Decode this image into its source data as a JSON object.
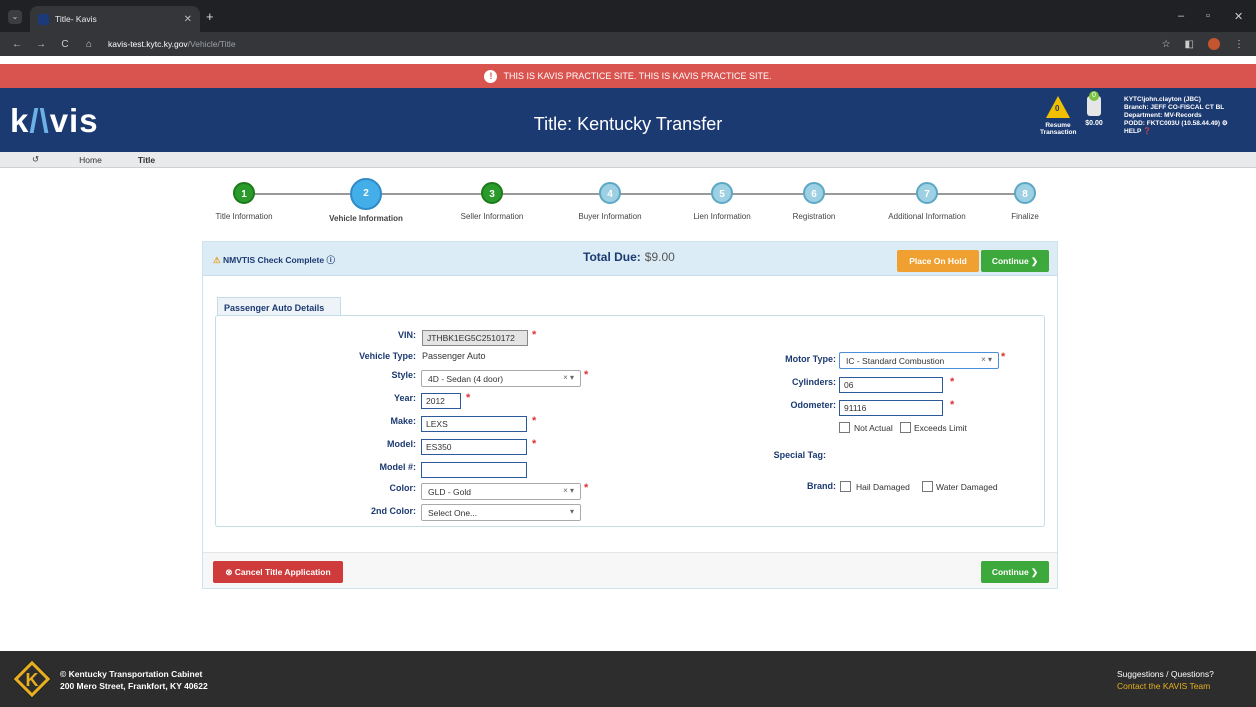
{
  "browser": {
    "tab_title": "Title- Kavis",
    "url_domain": "kavis-test.kytc.ky.gov",
    "url_path": "/Vehicle/Title"
  },
  "banner": {
    "text": "THIS IS KAVIS PRACTICE SITE. THIS IS KAVIS PRACTICE SITE."
  },
  "header": {
    "logo_k": "k",
    "logo_a": "/\\",
    "logo_rest": "vis",
    "title": "Title: Kentucky Transfer",
    "resume_count": "0",
    "resume_label_1": "Resume",
    "resume_label_2": "Transaction",
    "cart_count": "0",
    "cart_amount": "$0.00",
    "user_line1": "KYTC\\john.clayton (JBC)",
    "user_line2": "Branch: JEFF CO-FISCAL CT BL",
    "user_line3": "Department: MV-Records",
    "user_line4": "PODD: FKTC003U (10.58.44.49) ⚙",
    "help": "HELP ❓"
  },
  "breadcrumb": {
    "back": "↺",
    "home": "Home",
    "current": "Title"
  },
  "steps": [
    {
      "num": "1",
      "label": "Title Information"
    },
    {
      "num": "2",
      "label": "Vehicle Information"
    },
    {
      "num": "3",
      "label": "Seller Information"
    },
    {
      "num": "4",
      "label": "Buyer Information"
    },
    {
      "num": "5",
      "label": "Lien Information"
    },
    {
      "num": "6",
      "label": "Registration"
    },
    {
      "num": "7",
      "label": "Additional Information"
    },
    {
      "num": "8",
      "label": "Finalize"
    }
  ],
  "card": {
    "nmvtis": "NMVTIS Check Complete",
    "total_label": "Total Due:",
    "total_value": "$9.00",
    "hold_btn": "Place On Hold",
    "continue_btn": "Continue ❯",
    "section_tab": "Passenger Auto Details",
    "cancel_btn": "⊗ Cancel Title Application"
  },
  "form": {
    "vin_label": "VIN:",
    "vin": "JTHBK1EG5C2510172",
    "type_label": "Vehicle Type:",
    "type": "Passenger Auto",
    "style_label": "Style:",
    "style": "4D - Sedan (4 door)",
    "year_label": "Year:",
    "year": "2012",
    "make_label": "Make:",
    "make": "LEXS",
    "model_label": "Model:",
    "model": "ES350",
    "modelnum_label": "Model #:",
    "modelnum": "",
    "color_label": "Color:",
    "color": "GLD - Gold",
    "color2_label": "2nd Color:",
    "color2": "Select One...",
    "motor_label": "Motor Type:",
    "motor": "IC - Standard Combustion",
    "cyl_label": "Cylinders:",
    "cyl": "06",
    "odo_label": "Odometer:",
    "odo": "91116",
    "not_actual": "Not Actual",
    "exceeds": "Exceeds Limit",
    "special_label": "Special Tag:",
    "brand_label": "Brand:",
    "hail": "Hail Damaged",
    "water": "Water Damaged"
  },
  "footer": {
    "org": "© Kentucky Transportation Cabinet",
    "address": "200 Mero Street, Frankfort, KY 40622",
    "suggest": "Suggestions / Questions?",
    "contact": "Contact the KAVIS Team"
  }
}
